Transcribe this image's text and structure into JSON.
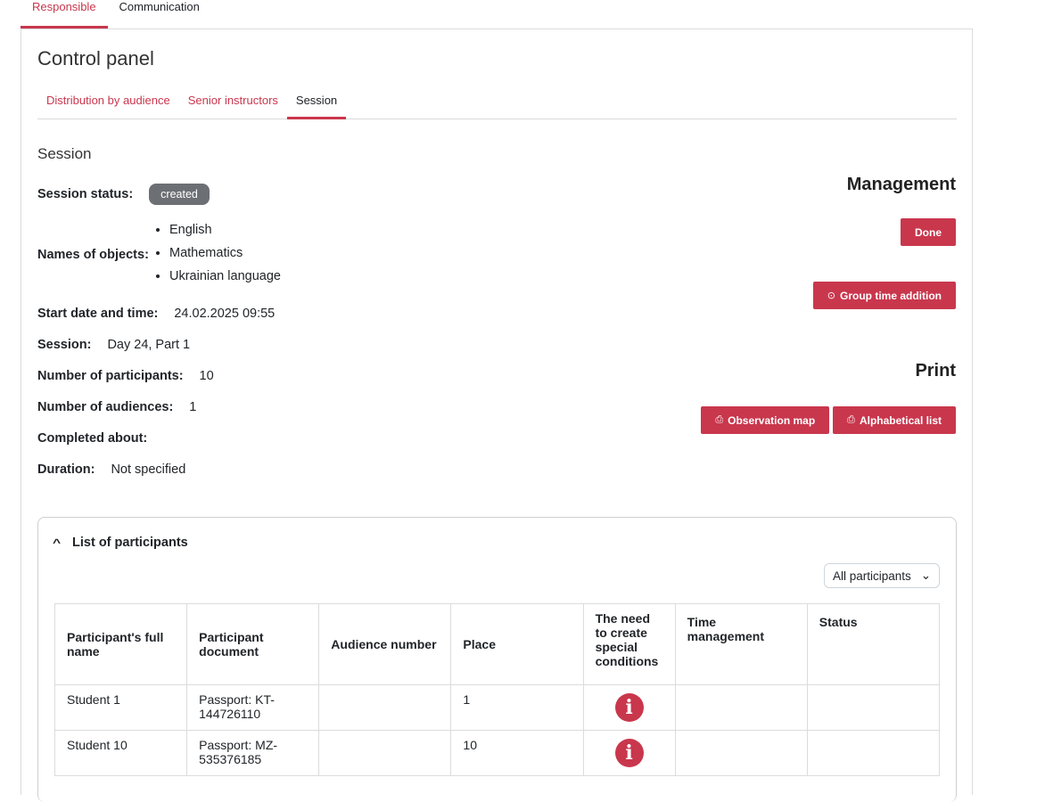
{
  "top_tabs": [
    "Responsible",
    "Communication"
  ],
  "page_title": "Control panel",
  "sub_tabs": [
    "Distribution by audience",
    "Senior instructors",
    "Session"
  ],
  "section_title": "Session",
  "session_status": {
    "label": "Session status:",
    "value": "created"
  },
  "objects": {
    "label": "Names of objects:",
    "items": [
      "English",
      "Mathematics",
      "Ukrainian language"
    ]
  },
  "start": {
    "label": "Start date and time:",
    "value": "24.02.2025 09:55"
  },
  "session": {
    "label": "Session:",
    "value": "Day 24, Part 1"
  },
  "participants_count": {
    "label": "Number of participants:",
    "value": "10"
  },
  "audiences_count": {
    "label": "Number of audiences:",
    "value": "1"
  },
  "completed": {
    "label": "Completed about:",
    "value": ""
  },
  "duration": {
    "label": "Duration:",
    "value": "Not specified"
  },
  "management": {
    "title": "Management",
    "done_label": "Done",
    "group_time_label": "Group time addition"
  },
  "print": {
    "title": "Print",
    "observation_label": "Observation map",
    "alphabetical_label": "Alphabetical list"
  },
  "participants_section": {
    "title": "List of participants",
    "filter": "All participants",
    "columns": [
      "Participant's full name",
      "Participant document",
      "Audience number",
      "Place",
      "The need to create special conditions",
      "Time management",
      "Status"
    ],
    "rows": [
      {
        "name": "Student 1",
        "document": "Passport: KT-144726110",
        "audience": "",
        "place": "1",
        "time": "",
        "status": ""
      },
      {
        "name": "Student 10",
        "document": "Passport: MZ-535376185",
        "audience": "",
        "place": "10",
        "time": "",
        "status": ""
      }
    ]
  },
  "colors": {
    "accent": "#c9374d",
    "badge": "#6c6f73"
  }
}
